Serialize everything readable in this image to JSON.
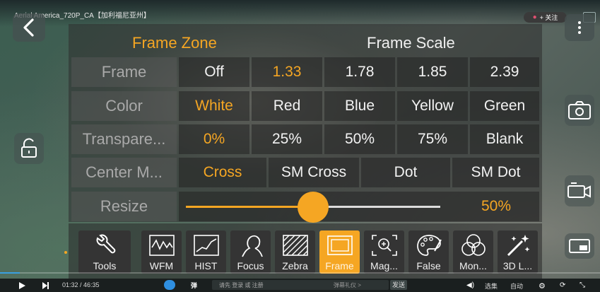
{
  "video": {
    "title": "Aerial America_720P_CA【加利福尼亚州】",
    "follow_label": "+ 关注"
  },
  "panel": {
    "header_zone": "Frame Zone",
    "header_scale": "Frame Scale",
    "rows": {
      "frame": {
        "label": "Frame",
        "options": [
          "Off",
          "1.33",
          "1.78",
          "1.85",
          "2.39"
        ],
        "selected": "1.33"
      },
      "color": {
        "label": "Color",
        "options": [
          "White",
          "Red",
          "Blue",
          "Yellow",
          "Green"
        ],
        "selected": "White"
      },
      "transparency": {
        "label": "Transpare...",
        "options": [
          "0%",
          "25%",
          "50%",
          "75%",
          "Blank"
        ],
        "selected": "0%"
      },
      "center": {
        "label": "Center M...",
        "options": [
          "Cross",
          "SM Cross",
          "Dot",
          "SM Dot"
        ],
        "selected": "Cross"
      },
      "resize": {
        "label": "Resize",
        "value_label": "50%",
        "value_fraction": 0.5
      }
    }
  },
  "toolbar": {
    "tools": [
      "Tools",
      "WFM",
      "HIST",
      "Focus",
      "Zebra",
      "Frame",
      "Mag...",
      "False",
      "Mon...",
      "3D L..."
    ],
    "active": "Frame"
  },
  "player": {
    "time": "01:32 / 46:35",
    "progress_fraction": 0.033,
    "danmaku_placeholder": "请先 登录 或 注册",
    "danmaku_hint": "弹幕礼仪 >",
    "send_label": "发送",
    "episodes_label": "选集",
    "quality_label": "自动",
    "danmaku_icon_label": "弹"
  },
  "colors": {
    "accent": "#f5a623",
    "progress": "#3aa0e0"
  }
}
